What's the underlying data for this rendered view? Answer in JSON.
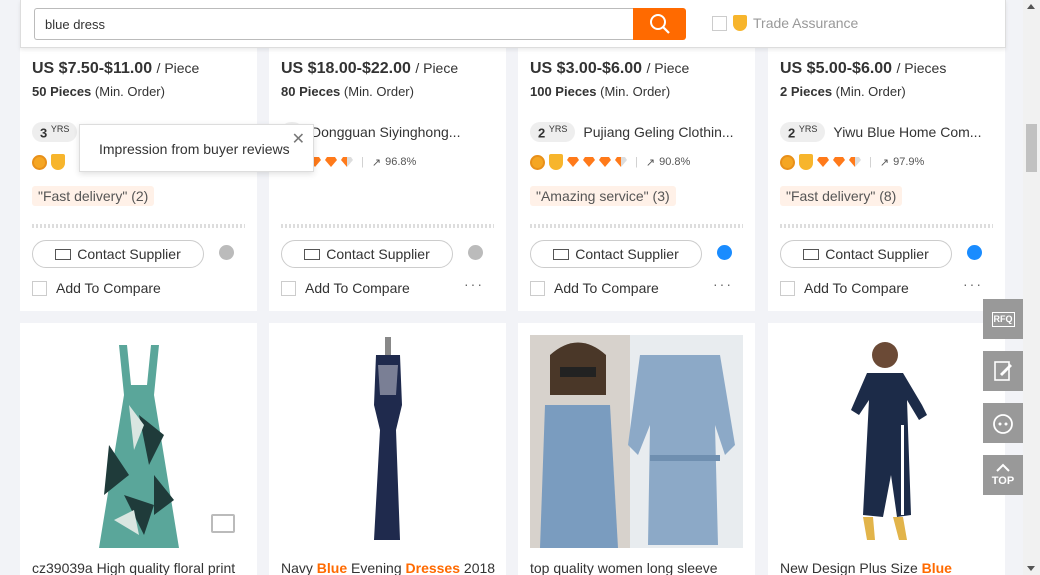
{
  "search": {
    "query": "blue dress"
  },
  "trade_assurance_label": "Trade Assurance",
  "tooltip": {
    "text": "Impression from buyer reviews"
  },
  "contact_label": "Contact Supplier",
  "compare_label": "Add To Compare",
  "more_label": "···",
  "cards": [
    {
      "price": "US $7.50-$11.00",
      "unit": "/ Piece",
      "moq_qty": "50 Pieces",
      "moq_label": "(Min. Order)",
      "years": "3",
      "yrs": "YRS",
      "supplier": "",
      "rating": "",
      "tag": "\"Fast delivery\" (2)"
    },
    {
      "price": "US $18.00-$22.00",
      "unit": "/ Piece",
      "moq_qty": "80 Pieces",
      "moq_label": "(Min. Order)",
      "years": "",
      "yrs": "S",
      "supplier": "Dongguan Siyinghong...",
      "rating": "96.8%",
      "tag": ""
    },
    {
      "price": "US $3.00-$6.00",
      "unit": "/ Piece",
      "moq_qty": "100 Pieces",
      "moq_label": "(Min. Order)",
      "years": "2",
      "yrs": "YRS",
      "supplier": "Pujiang Geling Clothin...",
      "rating": "90.8%",
      "tag": "\"Amazing service\" (3)"
    },
    {
      "price": "US $5.00-$6.00",
      "unit": "/ Pieces",
      "moq_qty": "2 Pieces",
      "moq_label": "(Min. Order)",
      "years": "2",
      "yrs": "YRS",
      "supplier": "Yiwu Blue Home Com...",
      "rating": "97.9%",
      "tag": "\"Fast delivery\" (8)"
    }
  ],
  "products": [
    {
      "t1": "cz39039a High quality floral print",
      "hl1": "",
      "t2": "",
      "hl2": "",
      "t3": ""
    },
    {
      "t1": "Navy ",
      "hl1": "Blue",
      "t2": " Evening ",
      "hl2": "Dresses",
      "t3": " 2018"
    },
    {
      "t1": "top quality women long sleeve",
      "hl1": "",
      "t2": "",
      "hl2": "",
      "t3": ""
    },
    {
      "t1": "New Design Plus Size ",
      "hl1": "Blue",
      "t2": "",
      "hl2": "",
      "t3": ""
    }
  ],
  "side": {
    "rfq": "RFQ",
    "top": "TOP"
  }
}
